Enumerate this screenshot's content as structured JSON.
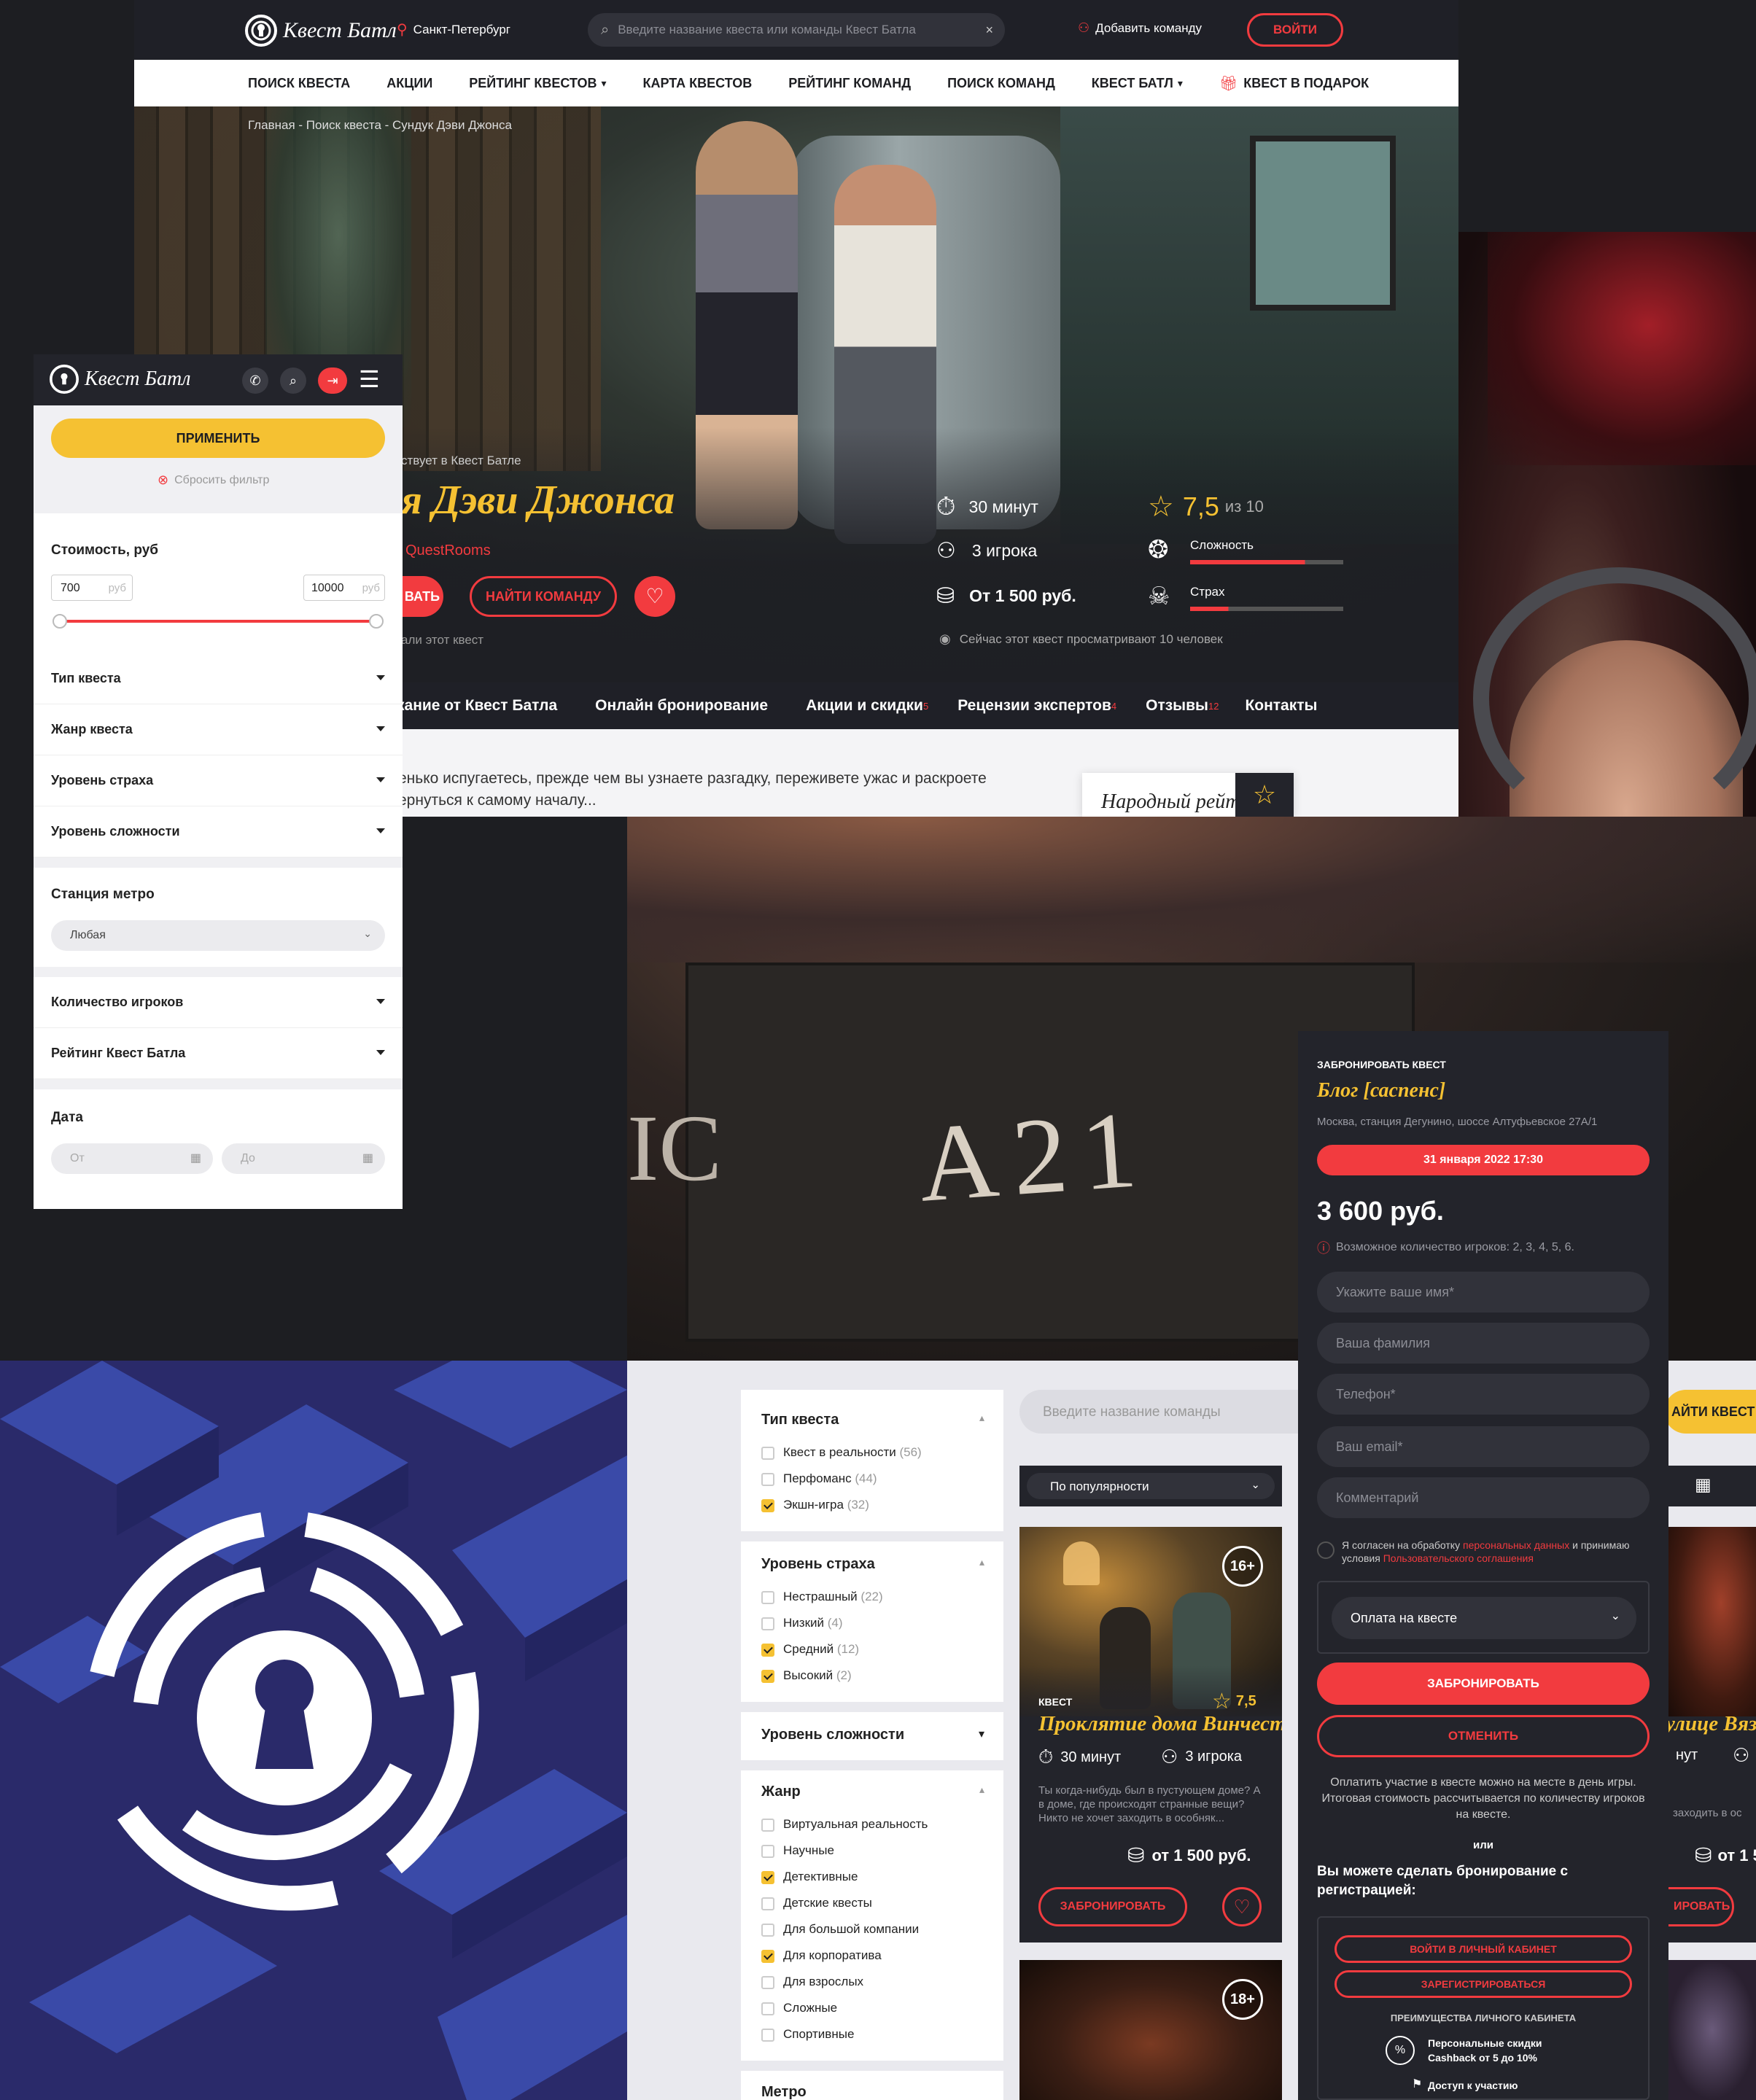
{
  "header": {
    "brand": "Квест Батл",
    "city": "Санкт-Петербург",
    "search_placeholder": "Введите название квеста или команды Квест Батла",
    "add_team": "Добавить команду",
    "login": "ВОЙТИ"
  },
  "nav": [
    "ПОИСК КВЕСТА",
    "АКЦИИ",
    "РЕЙТИНГ КВЕСТОВ",
    "КАРТА КВЕСТОВ",
    "РЕЙТИНГ КОМАНД",
    "ПОИСК КОМАНД",
    "КВЕСТ БАТЛ",
    "КВЕСТ В ПОДАРОК"
  ],
  "hero": {
    "breadcrumb": "Главная - Поиск квеста - Сундук Дэви Джонса",
    "participates": "ствует в Квест Батле",
    "title": "я Дэви Джонса",
    "organizer": "QuestRooms",
    "book_btn": "ВАТЬ",
    "find_team_btn": "НАЙТИ КОМАНДУ",
    "liked": "али этот квест",
    "duration": "30 минут",
    "players": "3 игрока",
    "price": "От 1 500 руб.",
    "rating": "7,5",
    "rating_of": "из 10",
    "difficulty_label": "Сложность",
    "fear_label": "Страх",
    "watching": "Сейчас этот квест просматривают 10 человек"
  },
  "tabs": [
    {
      "label": "кание от Квест Батла",
      "sup": ""
    },
    {
      "label": "Онлайн бронирование",
      "sup": ""
    },
    {
      "label": "Акции и скидки",
      "sup": "5"
    },
    {
      "label": "Рецензии экспертов",
      "sup": "4"
    },
    {
      "label": "Отзывы",
      "sup": "12"
    },
    {
      "label": "Контакты",
      "sup": ""
    }
  ],
  "description": {
    "line1": "енько испугаетесь, прежде чем вы узнаете разгадку, переживете ужас и раскроете",
    "line2": "ернуться к самому началу...",
    "people_rating": "Народный рейтинг"
  },
  "mobile_filter": {
    "brand": "Квест Батл",
    "apply": "ПРИМЕНИТЬ",
    "reset": "Сбросить фильтр",
    "cost_label": "Стоимость, руб",
    "min": "700",
    "max": "10000",
    "unit": "руб",
    "rows": [
      "Тип квеста",
      "Жанр квеста",
      "Уровень страха",
      "Уровень сложности"
    ],
    "metro_label": "Станция метро",
    "metro_value": "Любая",
    "rows2": [
      "Количество игроков",
      "Рейтинг Квест Батла"
    ],
    "date_label": "Дата",
    "from": "От",
    "to": "До"
  },
  "catalog": {
    "type_title": "Тип квеста",
    "types": [
      {
        "label": "Квест в реальности",
        "count": "(56)",
        "on": false
      },
      {
        "label": "Перфоманс",
        "count": "(44)",
        "on": false
      },
      {
        "label": "Экшн-игра",
        "count": "(32)",
        "on": true
      }
    ],
    "fear_title": "Уровень страха",
    "fears": [
      {
        "label": "Нестрашный",
        "count": "(22)",
        "on": false
      },
      {
        "label": "Низкий",
        "count": "(4)",
        "on": false
      },
      {
        "label": "Средний",
        "count": "(12)",
        "on": true
      },
      {
        "label": "Высокий",
        "count": "(2)",
        "on": true
      }
    ],
    "diff_title": "Уровень сложности",
    "genre_title": "Жанр",
    "genres": [
      {
        "label": "Виртуальная реальность",
        "on": false
      },
      {
        "label": "Научные",
        "on": false
      },
      {
        "label": "Детективные",
        "on": true
      },
      {
        "label": "Детские квесты",
        "on": false
      },
      {
        "label": "Для большой компании",
        "on": false
      },
      {
        "label": "Для корпоратива",
        "on": true
      },
      {
        "label": "Для взрослых",
        "on": false
      },
      {
        "label": "Сложные",
        "on": false
      },
      {
        "label": "Спортивные",
        "on": false
      }
    ],
    "metro_title": "Метро",
    "team_placeholder": "Введите название команды",
    "sort": "По популярности",
    "find_team": "АЙТИ КВЕСТ",
    "card": {
      "age": "16+",
      "kind": "КВЕСТ",
      "rating": "7,5",
      "title": "Проклятие дома Винчестеров",
      "duration": "30 минут",
      "players": "3 игрока",
      "desc": "Ты когда-нибудь был в пустующем доме? А в доме, где происходят странные вещи? Никто не хочет заходить в особняк...",
      "price": "от 1 500 руб.",
      "book": "ЗАБРОНИРОВАТЬ"
    },
    "card2_age": "18+",
    "right_card": {
      "title": "улице Вязо",
      "dur": "нут",
      "desc": "заходить в ос",
      "price": "от 1 5",
      "book": "ИРОВАТЬ"
    }
  },
  "booking": {
    "header": "ЗАБРОНИРОВАТЬ КВЕСТ",
    "quest": "Блог [саспенс]",
    "address": "Москва, станция Дегунино, шоссе Алтуфьевское 27А/1",
    "datetime": "31 января 2022 17:30",
    "price": "3 600 руб.",
    "players_note": "Возможное количество игроков: 2, 3, 4, 5, 6.",
    "fields": [
      "Укажите ваше имя*",
      "Ваша фамилия",
      "Телефон*",
      "Ваш email*",
      "Комментарий"
    ],
    "consent_1": "Я согласен на обработку ",
    "consent_link1": "персональных данных",
    "consent_2": " и принимаю условия ",
    "consent_link2": "Пользовательского соглашения",
    "payment": "Оплата на квесте",
    "book": "ЗАБРОНИРОВАТЬ",
    "cancel": "ОТМЕНИТЬ",
    "pay_note": "Оплатить участие в квесте можно на месте в день игры. Итоговая стоимость рассчитывается по количеству игроков на квесте.",
    "or": "или",
    "reg_note": "Вы можете сделать бронирование с регистрацией:",
    "login_cabinet": "ВОЙТИ В ЛИЧНЫЙ КАБИНЕТ",
    "register": "ЗАРЕГИСТРИРОВАТЬСЯ",
    "benefits": "ПРЕИМУЩЕСТВА ЛИЧНОГО КАБИНЕТА",
    "benefit1a": "Персональные скидки",
    "benefit1b": "Cashback от 5 до 10%",
    "benefit2": "Доступ к участию"
  },
  "chalk_text": "A21",
  "colors": {
    "accent_red": "#f23b3f",
    "accent_yellow": "#f5c132",
    "dark": "#23242b",
    "blue": "#2a2a6a"
  }
}
